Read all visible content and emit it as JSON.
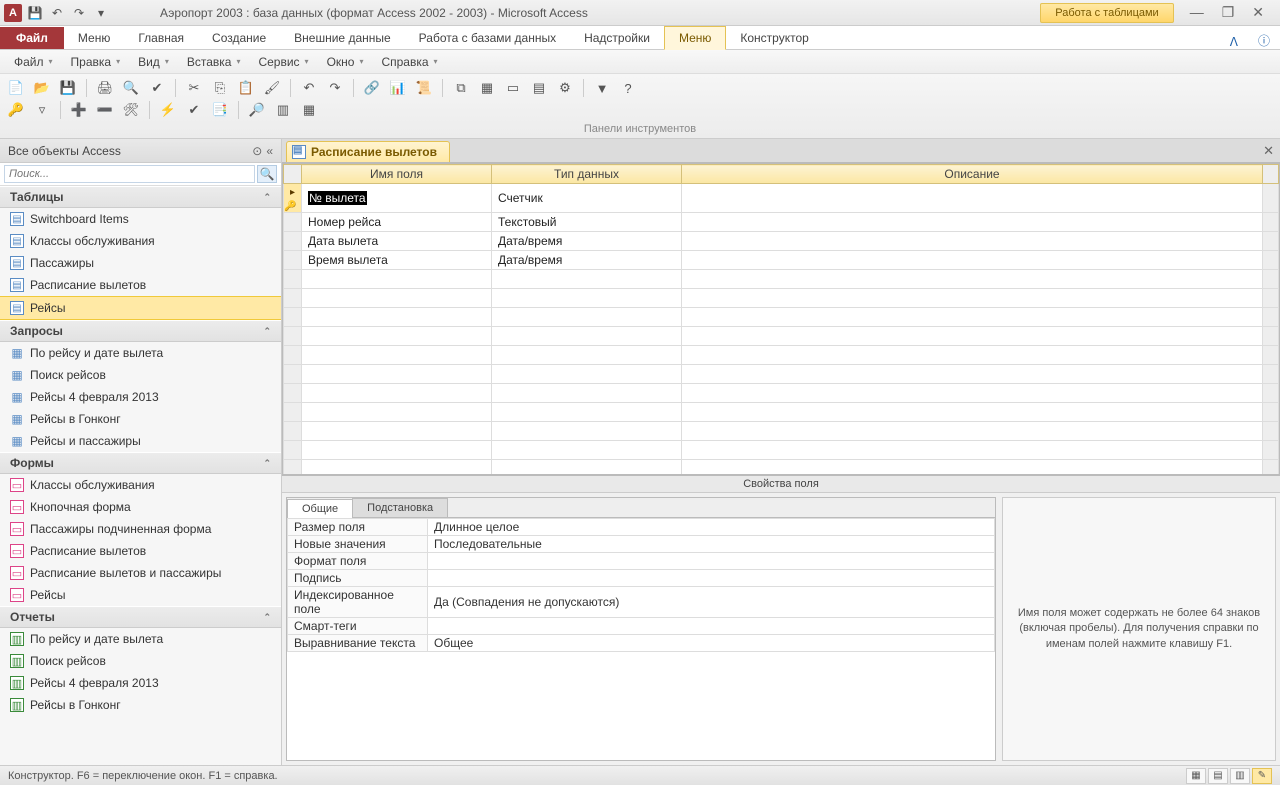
{
  "titlebar": {
    "app_letter": "A",
    "title": "Аэропорт 2003 : база данных (формат Access 2002 - 2003)  -  Microsoft Access",
    "contextual": "Работа с таблицами"
  },
  "ribbon": {
    "file": "Файл",
    "tabs": [
      "Меню",
      "Главная",
      "Создание",
      "Внешние данные",
      "Работа с базами данных",
      "Надстройки"
    ],
    "ctx_tabs": [
      "Меню",
      "Конструктор"
    ]
  },
  "menurow": [
    "Файл",
    "Правка",
    "Вид",
    "Вставка",
    "Сервис",
    "Окно",
    "Справка"
  ],
  "panel_label": "Панели инструментов",
  "nav": {
    "header": "Все объекты Access",
    "search_placeholder": "Поиск...",
    "groups": {
      "tables": {
        "label": "Таблицы",
        "items": [
          "Switchboard Items",
          "Классы обслуживания",
          "Пассажиры",
          "Расписание вылетов",
          "Рейсы"
        ],
        "selected": 4
      },
      "queries": {
        "label": "Запросы",
        "items": [
          "По рейсу и дате вылета",
          "Поиск рейсов",
          "Рейсы 4 февраля 2013",
          "Рейсы в Гонконг",
          "Рейсы и пассажиры"
        ]
      },
      "forms": {
        "label": "Формы",
        "items": [
          "Классы обслуживания",
          "Кнопочная форма",
          "Пассажиры подчиненная форма",
          "Расписание вылетов",
          "Расписание вылетов и пассажиры",
          "Рейсы"
        ]
      },
      "reports": {
        "label": "Отчеты",
        "items": [
          "По рейсу и дате вылета",
          "Поиск рейсов",
          "Рейсы 4  февраля 2013",
          "Рейсы в Гонконг"
        ]
      }
    }
  },
  "design": {
    "tab_label": "Расписание вылетов",
    "columns": {
      "name": "Имя поля",
      "type": "Тип данных",
      "desc": "Описание"
    },
    "rows": [
      {
        "name": "№ вылета",
        "type": "Счетчик",
        "desc": "",
        "pk": true,
        "active": true
      },
      {
        "name": "Номер рейса",
        "type": "Текстовый",
        "desc": ""
      },
      {
        "name": "Дата вылета",
        "type": "Дата/время",
        "desc": ""
      },
      {
        "name": "Время вылета",
        "type": "Дата/время",
        "desc": ""
      }
    ]
  },
  "props": {
    "title": "Свойства поля",
    "tabs": [
      "Общие",
      "Подстановка"
    ],
    "rows": [
      {
        "label": "Размер поля",
        "value": "Длинное целое"
      },
      {
        "label": "Новые значения",
        "value": "Последовательные"
      },
      {
        "label": "Формат поля",
        "value": ""
      },
      {
        "label": "Подпись",
        "value": ""
      },
      {
        "label": "Индексированное поле",
        "value": "Да (Совпадения не допускаются)"
      },
      {
        "label": "Смарт-теги",
        "value": ""
      },
      {
        "label": "Выравнивание текста",
        "value": "Общее"
      }
    ],
    "hint": "Имя поля может содержать не более 64 знаков (включая пробелы). Для получения справки по именам полей нажмите клавишу F1."
  },
  "status": "Конструктор.   F6 = переключение окон.   F1 = справка."
}
